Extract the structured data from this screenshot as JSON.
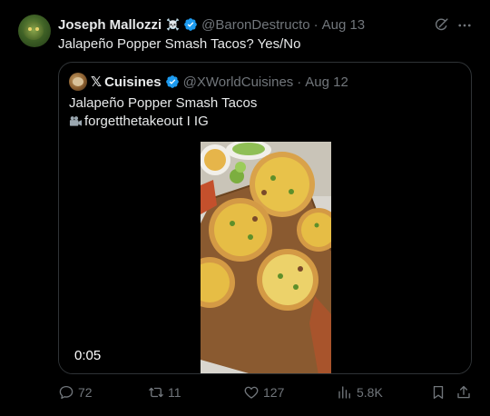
{
  "tweet": {
    "author": {
      "display_name": "Joseph Mallozzi",
      "badge_emoji": "☠️",
      "handle": "@BaronDestructo",
      "time": "Aug 13"
    },
    "text": "Jalapeño Popper Smash Tacos?  Yes/No",
    "icons": [
      "grok-icon",
      "more-icon"
    ]
  },
  "quote": {
    "author": {
      "display_name": "Cuisines",
      "x_logo": "𝕏",
      "handle": "@XWorldCuisines",
      "time": "Aug 12"
    },
    "text_line1": "Jalapeño Popper Smash Tacos",
    "text_line2": "forgetthetakeout I IG",
    "video": {
      "duration": "0:05"
    }
  },
  "actions": {
    "replies": "72",
    "reposts": "11",
    "likes": "127",
    "views": "5.8K"
  },
  "colors": {
    "background": "#000000",
    "text": "#e7e9ea",
    "muted": "#71767b",
    "verified": "#1d9bf0",
    "border": "#2f3336"
  }
}
